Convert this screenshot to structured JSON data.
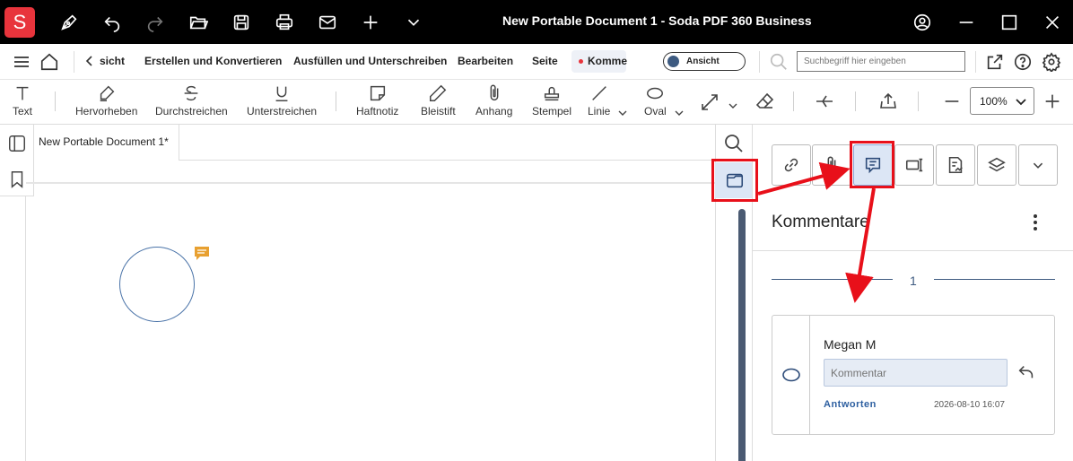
{
  "window": {
    "logo_letter": "S",
    "title": "New Portable Document 1   -   Soda PDF 360 Business"
  },
  "menu": {
    "items": [
      "sicht",
      "Erstellen und Konvertieren",
      "Ausfüllen und Unterschreiben",
      "Bearbeiten",
      "Seite",
      "Komme"
    ],
    "active_dot_color": "#e8343c",
    "view_toggle_label": "Ansicht",
    "search_placeholder": "Suchbegriff hier eingeben"
  },
  "toolbar": {
    "tools": [
      {
        "label": "Text",
        "icon": "text-icon"
      },
      {
        "label": "Hervorheben",
        "icon": "highlighter-icon"
      },
      {
        "label": "Durchstreichen",
        "icon": "strikethrough-icon"
      },
      {
        "label": "Unterstreichen",
        "icon": "underline-icon"
      },
      {
        "label": "Haftnotiz",
        "icon": "sticky-note-icon"
      },
      {
        "label": "Bleistift",
        "icon": "pencil-icon"
      },
      {
        "label": "Anhang",
        "icon": "paperclip-icon"
      },
      {
        "label": "Stempel",
        "icon": "stamp-icon"
      },
      {
        "label": "Linie",
        "icon": "line-icon"
      },
      {
        "label": "Oval",
        "icon": "oval-icon"
      }
    ],
    "zoom": "100%"
  },
  "document": {
    "tab_label": "New Portable Document 1*"
  },
  "panel": {
    "title": "Kommentare",
    "group_label": "1",
    "comment": {
      "author": "Megan M",
      "placeholder": "Kommentar",
      "reply_label": "Antworten",
      "timestamp": "2026-08-10 16:07"
    }
  },
  "colors": {
    "accent": "#3d5a80",
    "annotation_red": "#e8101a",
    "note_icon": "#e8a030",
    "brand": "#e8343c"
  }
}
